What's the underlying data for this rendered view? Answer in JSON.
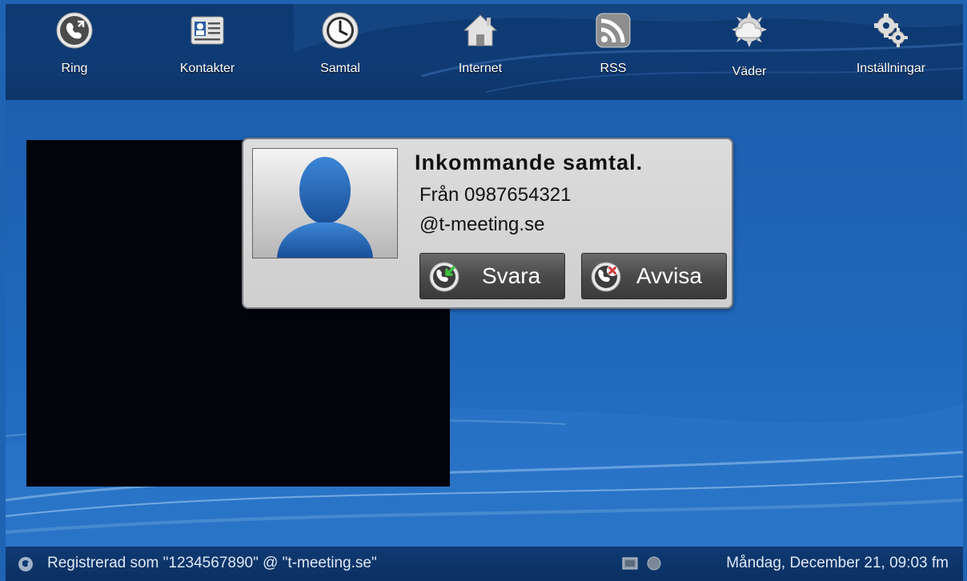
{
  "nav": {
    "items": [
      {
        "label": "Ring",
        "icon": "phone-icon"
      },
      {
        "label": "Kontakter",
        "icon": "contacts-card-icon"
      },
      {
        "label": "Samtal",
        "icon": "clock-icon"
      },
      {
        "label": "Internet",
        "icon": "home-icon"
      },
      {
        "label": "RSS",
        "icon": "rss-icon"
      },
      {
        "label": "Väder",
        "icon": "weather-cloud-icon"
      },
      {
        "label": "Inställningar",
        "icon": "gears-icon"
      }
    ]
  },
  "dialog": {
    "title": "Inkommande samtal.",
    "from": "Från 0987654321",
    "domain": "@t-meeting.se",
    "answer_label": "Svara",
    "reject_label": "Avvisa"
  },
  "status": {
    "registration": "Registrerad som \"1234567890\" @ \"t-meeting.se\"",
    "datetime": "Måndag, December 21, 09:03 fm"
  },
  "colors": {
    "accent_dark": "#0e3a72",
    "desktop_blue": "#1f63b3",
    "answer_green": "#3fbf3f",
    "reject_red": "#d43a3a"
  }
}
